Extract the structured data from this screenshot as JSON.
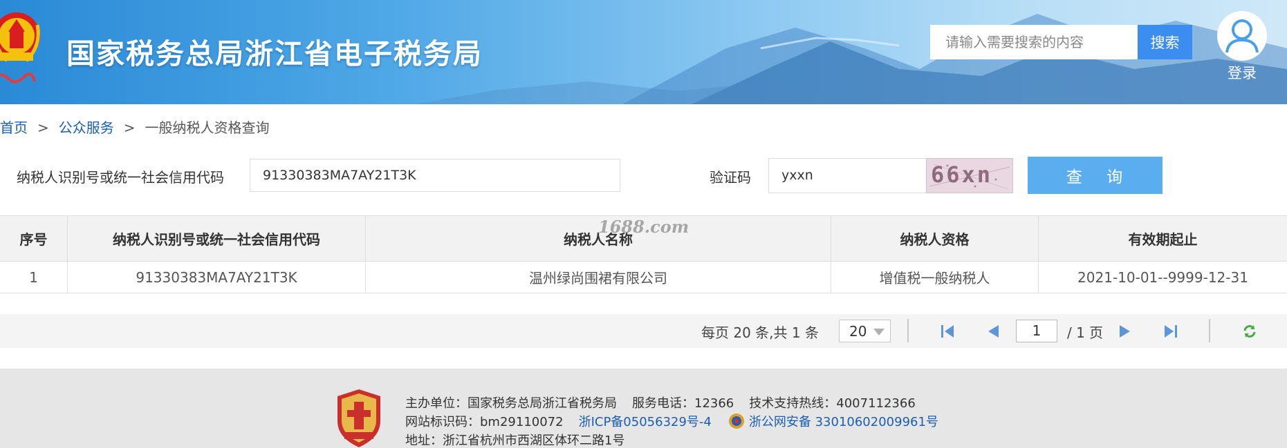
{
  "header": {
    "site_title": "国家税务总局浙江省电子税务局",
    "search_placeholder": "请输入需要搜索的内容",
    "search_button": "搜索",
    "login_label": "登录"
  },
  "breadcrumb": {
    "home": "首页",
    "separator": ">",
    "public_service": "公众服务",
    "current": "一般纳税人资格查询"
  },
  "query_form": {
    "taxpayer_id_label": "纳税人识别号或统一社会信用代码",
    "taxpayer_id_value": "91330383MA7AY21T3K",
    "captcha_label": "验证码",
    "captcha_value": "yxxn",
    "captcha_image_text": "66xn",
    "query_button": "查 询"
  },
  "watermark": "1688.com",
  "result_table": {
    "columns": [
      "序号",
      "纳税人识别号或统一社会信用代码",
      "纳税人名称",
      "纳税人资格",
      "有效期起止"
    ],
    "rows": [
      [
        "1",
        "91330383MA7AY21T3K",
        "温州绿尚围裙有限公司",
        "增值税一般纳税人",
        "2021-10-01--9999-12-31"
      ]
    ]
  },
  "pagination": {
    "per_page_text": "每页 20 条,共 1 条",
    "page_size": "20",
    "current_page": "1",
    "total_pages_text": "/ 1 页"
  },
  "footer": {
    "sponsor": "主办单位：国家税务总局浙江省税务局",
    "service_phone": "服务电话：12366",
    "support_hotline": "技术支持热线：4007112366",
    "site_code": "网站标识码：bm29110072",
    "icp": "浙ICP备05056329号-4",
    "police_record": "浙公网安备 33010602009961号",
    "address": "地址：浙江省杭州市西湖区体环二路1号"
  },
  "colors": {
    "link": "#1a5fb4",
    "search_button": "#3b8ef0",
    "query_button": "#5aaef0",
    "header_blue": "#2a8ad6"
  }
}
